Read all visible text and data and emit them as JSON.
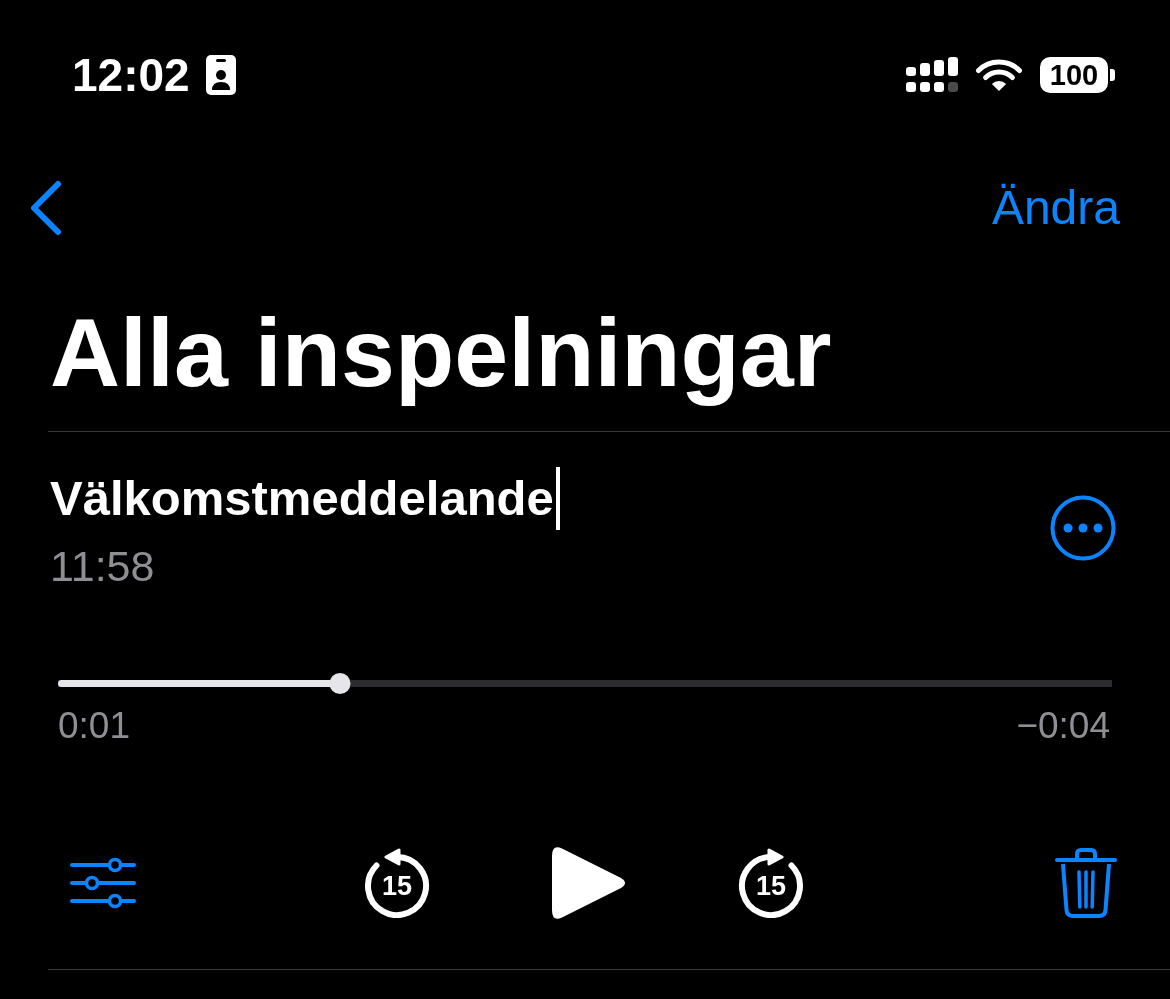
{
  "status_bar": {
    "time": "12:02",
    "battery": "100"
  },
  "navigation": {
    "action": "Ändra"
  },
  "title": "Alla inspelningar",
  "recording": {
    "name": "Välkomstmeddelande",
    "editing": true,
    "time": "11:58",
    "progress": {
      "level": 0.268
    },
    "elapsed": "0:01",
    "remaining": "−0:04"
  },
  "controls": [
    {
      "kind": "options"
    },
    {
      "kind": "skip_back",
      "label": "15"
    },
    {
      "kind": "play"
    },
    {
      "kind": "skip_forward",
      "label": "15"
    },
    {
      "kind": "delete"
    }
  ]
}
